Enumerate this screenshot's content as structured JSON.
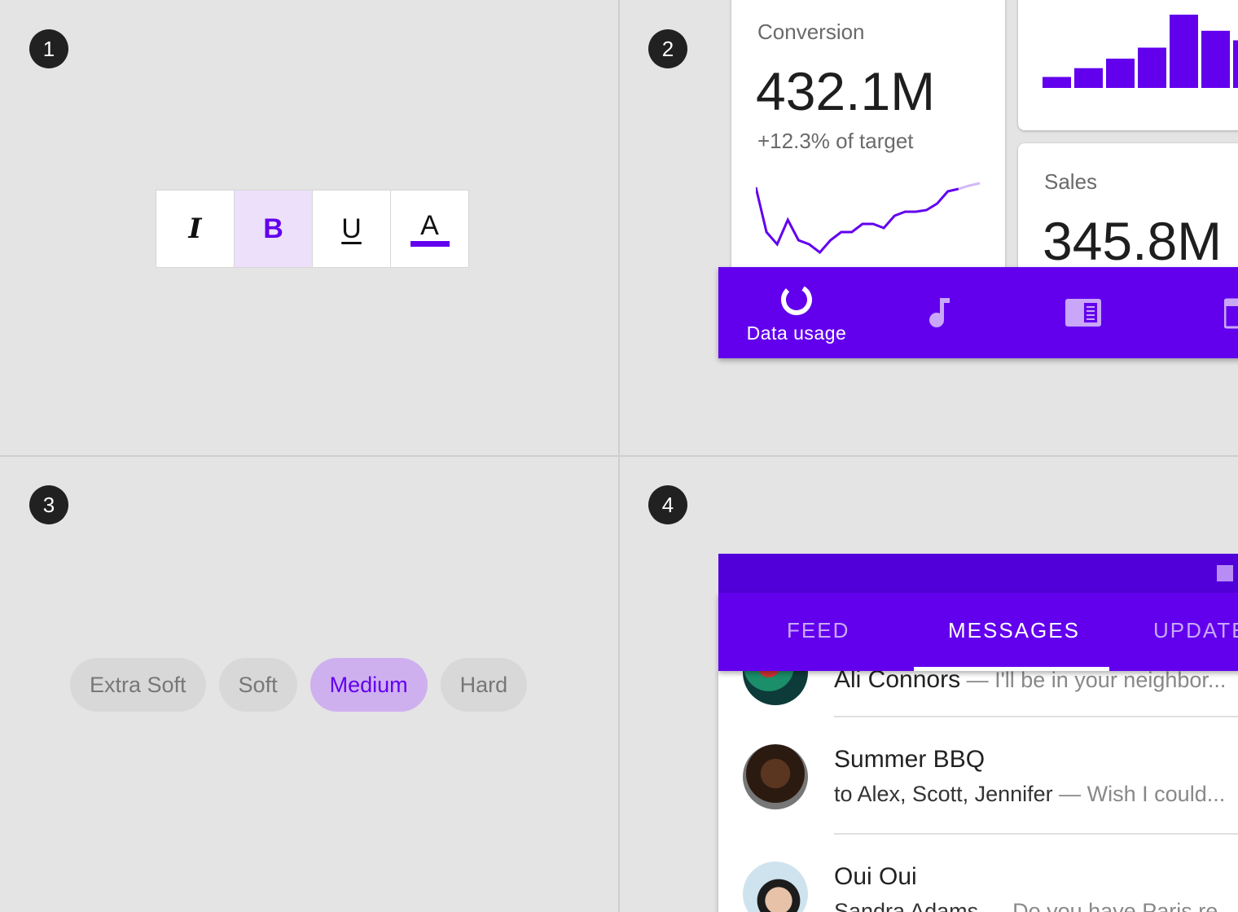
{
  "markers": [
    "1",
    "2",
    "3",
    "4"
  ],
  "q1": {
    "buttons": [
      {
        "name": "italic",
        "label": "I",
        "active": false
      },
      {
        "name": "bold",
        "label": "B",
        "active": true
      },
      {
        "name": "underline",
        "label": "U",
        "active": false
      },
      {
        "name": "text-color",
        "label": "A",
        "active": false
      }
    ],
    "colors": {
      "accent": "#6200ee",
      "active_bg": "#ede0fb"
    }
  },
  "q2": {
    "card_conversion": {
      "label": "Conversion",
      "value": "432.1M",
      "sub": "+12.3% of target"
    },
    "card_sales": {
      "label": "Sales",
      "value": "345.8M"
    },
    "bar_values": [
      0.15,
      0.27,
      0.4,
      0.55,
      1.0,
      0.78,
      0.65
    ],
    "line_values": [
      0.9,
      0.35,
      0.2,
      0.5,
      0.25,
      0.2,
      0.1,
      0.25,
      0.35,
      0.35,
      0.45,
      0.45,
      0.4,
      0.55,
      0.6,
      0.6,
      0.62,
      0.7,
      0.85,
      0.88,
      0.92,
      0.95
    ],
    "bottom_nav": [
      {
        "name": "data-usage",
        "label": "Data usage",
        "icon": "data-usage-icon"
      },
      {
        "name": "music",
        "label": "",
        "icon": "music-note-icon"
      },
      {
        "name": "news",
        "label": "",
        "icon": "newspaper-icon"
      },
      {
        "name": "calendar",
        "label": "",
        "icon": "calendar-icon"
      }
    ]
  },
  "q3": {
    "chips": [
      {
        "label": "Extra Soft",
        "selected": false
      },
      {
        "label": "Soft",
        "selected": false
      },
      {
        "label": "Medium",
        "selected": true
      },
      {
        "label": "Hard",
        "selected": false
      }
    ]
  },
  "q4": {
    "tabs": [
      {
        "label": "FEED",
        "active": false
      },
      {
        "label": "MESSAGES",
        "active": true
      },
      {
        "label": "UPDATE",
        "active": false
      }
    ],
    "messages": [
      {
        "title": "Ali Connors",
        "snippet": " — I'll be in your neighbor..."
      },
      {
        "title": "Summer BBQ",
        "sub": "to Alex, Scott, Jennifer",
        "snippet": " — Wish I could..."
      },
      {
        "title": "Oui Oui",
        "sub": "Sandra Adams",
        "snippet": " — Do you have Paris re"
      }
    ]
  }
}
